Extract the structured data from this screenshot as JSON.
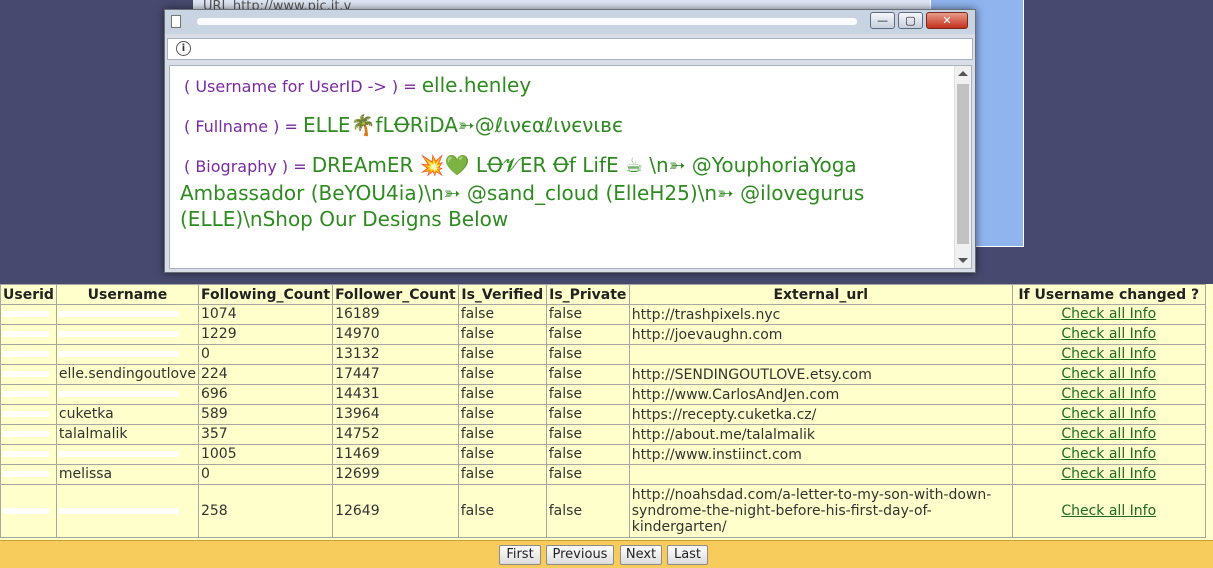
{
  "background": {
    "url_fragment": "URL  http://www.pic.it.v"
  },
  "popup": {
    "close_symbol": "✕",
    "min_symbol": "—",
    "max_symbol": "▢",
    "info_symbol": "i",
    "username_label": "( Username for UserID -> ",
    "username_label_end": " ) = ",
    "username_value": "elle.henley",
    "fullname_label": "( Fullname ) = ",
    "fullname_value": "ELLE🌴fLꝊRiDA➳@ℓινєαℓινєνιвє",
    "biography_label": "( Biography ) = ",
    "biography_value_line1": "DREAmER 💥💚 LꝊ𝓥ER Ꝋf LifE ☕ \\n➳ @YouphoriaYoga",
    "biography_value_line2": "Ambassador (BeYOU4ia)\\n➳ @sand_cloud (ElleH25)\\n➳ @ilovegurus",
    "biography_value_line3": "(ELLE)\\nShop Our Designs Below"
  },
  "table": {
    "headers": [
      "Userid",
      "Username",
      "Following_Count",
      "Follower_Count",
      "Is_Verified",
      "Is_Private",
      "External_url",
      "If Username changed ?"
    ],
    "link_label": "Check all Info",
    "rows": [
      {
        "username": "",
        "following": "1074",
        "follower": "16189",
        "verified": "false",
        "private": "false",
        "url": "http://trashpixels.nyc"
      },
      {
        "username": "",
        "following": "1229",
        "follower": "14970",
        "verified": "false",
        "private": "false",
        "url": "http://joevaughn.com"
      },
      {
        "username": "",
        "following": "0",
        "follower": "13132",
        "verified": "false",
        "private": "false",
        "url": ""
      },
      {
        "username": "elle.sendingoutlove",
        "following": "224",
        "follower": "17447",
        "verified": "false",
        "private": "false",
        "url": "http://SENDINGOUTLOVE.etsy.com"
      },
      {
        "username": "",
        "following": "696",
        "follower": "14431",
        "verified": "false",
        "private": "false",
        "url": "http://www.CarlosAndJen.com"
      },
      {
        "username": "cuketka",
        "following": "589",
        "follower": "13964",
        "verified": "false",
        "private": "false",
        "url": "https://recepty.cuketka.cz/"
      },
      {
        "username": "talalmalik",
        "following": "357",
        "follower": "14752",
        "verified": "false",
        "private": "false",
        "url": "http://about.me/talalmalik"
      },
      {
        "username": "",
        "following": "1005",
        "follower": "11469",
        "verified": "false",
        "private": "false",
        "url": "http://www.instiinct.com"
      },
      {
        "username": "melissa",
        "following": "0",
        "follower": "12699",
        "verified": "false",
        "private": "false",
        "url": ""
      },
      {
        "username": "",
        "following": "258",
        "follower": "12649",
        "verified": "false",
        "private": "false",
        "url": "http://noahsdad.com/a-letter-to-my-son-with-down-syndrome-the-night-before-his-first-day-of-kindergarten/"
      }
    ]
  },
  "pager": {
    "first": "First",
    "previous": "Previous",
    "next": "Next",
    "last": "Last"
  }
}
